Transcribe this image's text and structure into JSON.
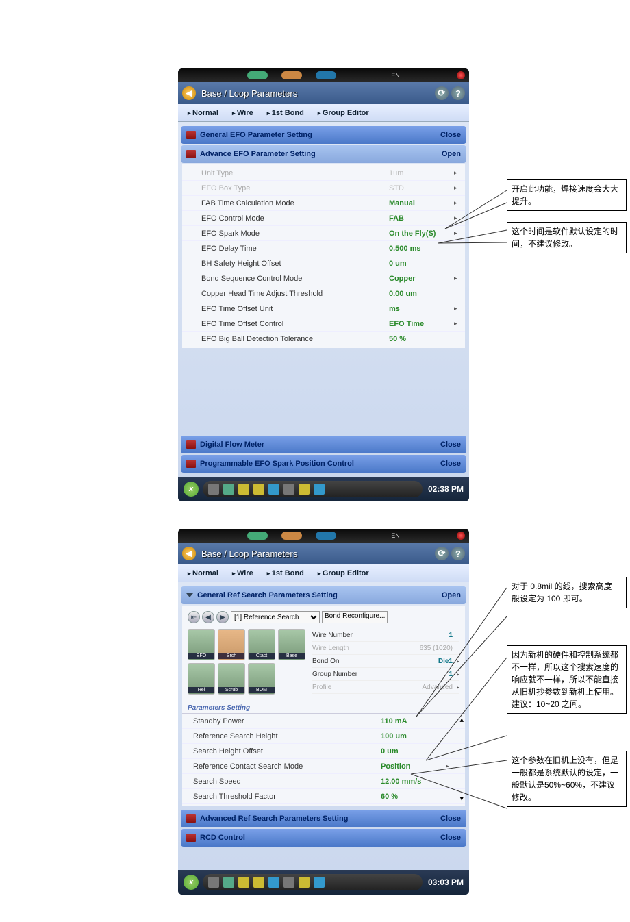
{
  "screen1": {
    "title": "Base / Loop Parameters",
    "tabs": [
      "Normal",
      "Wire",
      "1st Bond",
      "Group Editor"
    ],
    "sections": {
      "general_efo": {
        "label": "General EFO Parameter Setting",
        "action": "Close"
      },
      "advance_efo": {
        "label": "Advance EFO Parameter Setting",
        "action": "Open"
      },
      "digital_flow": {
        "label": "Digital Flow Meter",
        "action": "Close"
      },
      "prog_efo": {
        "label": "Programmable EFO Spark Position Control",
        "action": "Close"
      }
    },
    "rows": [
      {
        "label": "Unit Type",
        "value": "1um",
        "disabled": true,
        "caret": true
      },
      {
        "label": "EFO Box Type",
        "value": "STD",
        "disabled": true,
        "caret": true
      },
      {
        "label": "FAB Time Calculation Mode",
        "value": "Manual",
        "caret": true
      },
      {
        "label": "EFO Control Mode",
        "value": "FAB",
        "caret": true
      },
      {
        "label": "EFO Spark Mode",
        "value": "On the Fly(S)",
        "caret": true
      },
      {
        "label": "EFO Delay Time",
        "value": "0.500  ms"
      },
      {
        "label": "BH Safety Height Offset",
        "value": "0  um"
      },
      {
        "label": "Bond Sequence Control Mode",
        "value": "Copper",
        "caret": true
      },
      {
        "label": "Copper Head Time Adjust Threshold",
        "value": "0.00  um"
      },
      {
        "label": "EFO Time Offset Unit",
        "value": "ms",
        "caret": true
      },
      {
        "label": "EFO Time Offset Control",
        "value": "EFO Time",
        "caret": true
      },
      {
        "label": "EFO Big Ball Detection Tolerance",
        "value": "50  %"
      }
    ],
    "time": "02:38 PM"
  },
  "screen2": {
    "title": "Base / Loop Parameters",
    "tabs": [
      "Normal",
      "Wire",
      "1st Bond",
      "Group Editor"
    ],
    "sections": {
      "general_ref": {
        "label": "General Ref Search Parameters Setting",
        "action": "Open"
      },
      "adv_ref": {
        "label": "Advanced Ref Search Parameters Setting",
        "action": "Close"
      },
      "rcd": {
        "label": "RCD Control",
        "action": "Close"
      }
    },
    "dropdown_label": "[1] Reference Search",
    "bond_reconfigure": "Bond Reconfigure...",
    "icons": [
      "EFO",
      "Srch",
      "Ctact",
      "Base",
      "Rel",
      "Scrub",
      "BOM"
    ],
    "info": [
      {
        "label": "Wire Number",
        "value": "1"
      },
      {
        "label": "Wire Length",
        "value": "635 (1020)",
        "disabled": true
      },
      {
        "label": "Bond On",
        "value": "Die1",
        "caret": true
      },
      {
        "label": "Group Number",
        "value": "1",
        "caret": true
      },
      {
        "label": "Profile",
        "value": "Advanced",
        "disabled": true,
        "caret": true
      }
    ],
    "param_heading": "Parameters Setting",
    "params": [
      {
        "label": "Standby Power",
        "value": "110  mA"
      },
      {
        "label": "Reference Search Height",
        "value": "100  um"
      },
      {
        "label": "Search Height Offset",
        "value": "0  um"
      },
      {
        "label": "Reference Contact Search Mode",
        "value": "Position",
        "caret": true
      },
      {
        "label": "Search Speed",
        "value": "12.00  mm/s"
      },
      {
        "label": "Search Threshold Factor",
        "value": "60  %"
      }
    ],
    "time": "03:03 PM"
  },
  "annotations": {
    "a1": "开启此功能，焊接速度会大大提升。",
    "a2": "这个时间是软件默认设定的时间，不建议修改。",
    "a3": "对于 0.8mil 的线，搜索高度一般设定为 100 即可。",
    "a4": "因为新机的硬件和控制系统都不一样，所以这个搜索速度的响应就不一样，所以不能直接从旧机抄参数到新机上使用。建议：10~20 之间。",
    "a5": "这个参数在旧机上没有，但是一般都是系统默认的设定，一般默认是50%~60%，不建议修改。"
  },
  "sys": {
    "en": "EN"
  }
}
